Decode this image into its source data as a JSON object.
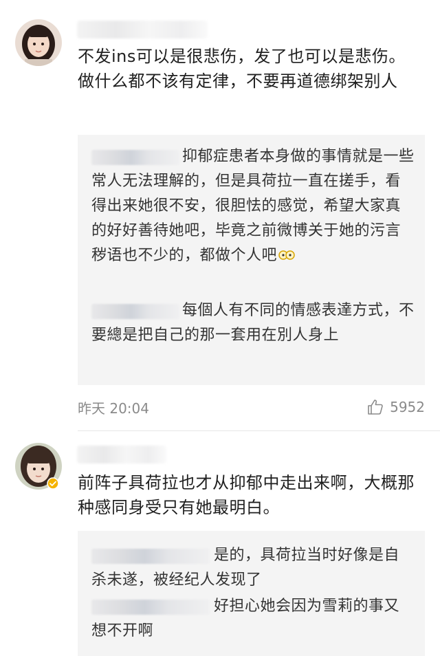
{
  "comments": [
    {
      "username": "",
      "text": "不发ins可以是很悲伤，发了也可以是悲伤。做什么都不该有定律，不要再道德绑架别人",
      "replies": [
        {
          "text": "抑郁症患者本身做的事情就是一些常人无法理解的，但是具荷拉一直在搓手，看得出来她很不安，很胆怯的感觉，希望大家真的好好善待她吧，毕竟之前微博关于她的污言秽语也不少的，都做个人吧",
          "emoji": "glasses-face-emoji"
        },
        {
          "text": "每個人有不同的情感表達方式，不要總是把自己的那一套用在別人身上"
        }
      ],
      "timestamp": "昨天 20:04",
      "like_icon": "thumbs-up-icon",
      "like_count": "5952"
    },
    {
      "username": "",
      "verified_icon": "verified-badge-icon",
      "text": "前阵子具荷拉也才从抑郁中走出来啊，大概那种感同身受只有她最明白。",
      "replies": [
        {
          "text": "是的，具荷拉当时好像是自杀未遂，被经纪人发现了"
        },
        {
          "text": "好担心她会因为雪莉的事又想不开啊"
        }
      ]
    }
  ],
  "colors": {
    "text": "#1f1f1f",
    "meta": "#8a8a8a",
    "reply_bg": "#f4f4f4",
    "verified": "#f5b300"
  }
}
